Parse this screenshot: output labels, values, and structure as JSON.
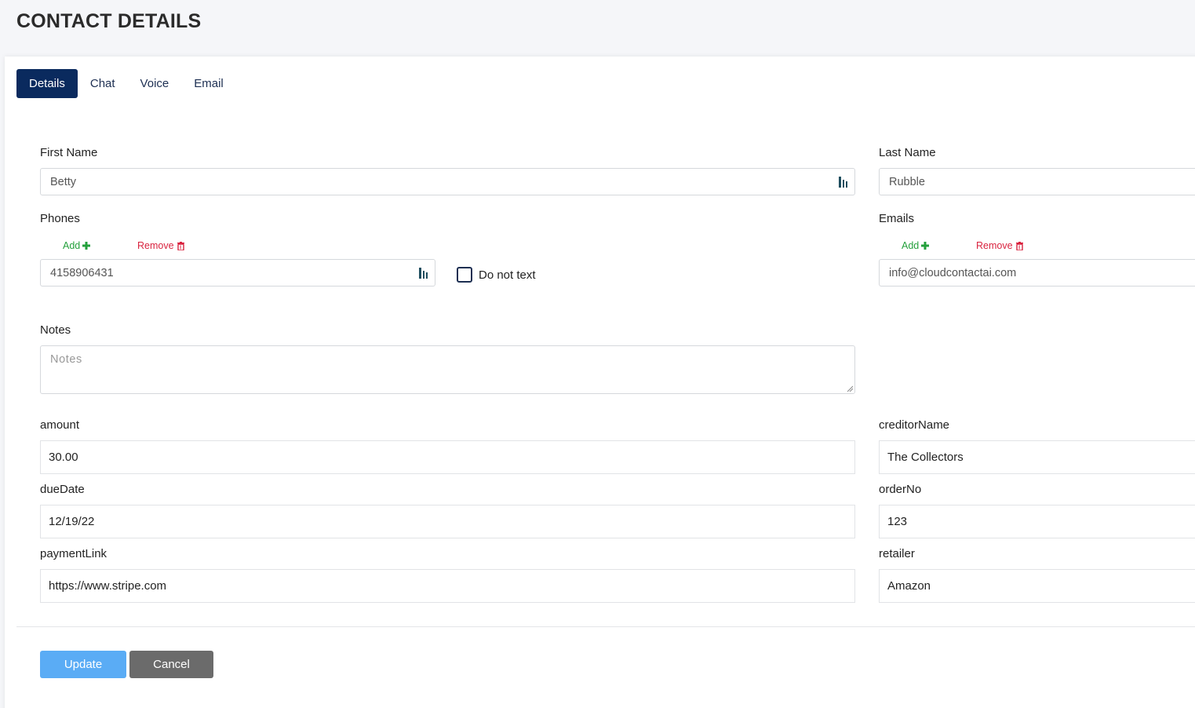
{
  "page": {
    "title": "CONTACT DETAILS"
  },
  "tabs": [
    {
      "label": "Details",
      "active": true
    },
    {
      "label": "Chat",
      "active": false
    },
    {
      "label": "Voice",
      "active": false
    },
    {
      "label": "Email",
      "active": false
    }
  ],
  "form": {
    "first_name": {
      "label": "First Name",
      "value": "Betty"
    },
    "last_name": {
      "label": "Last Name",
      "value": "Rubble"
    },
    "phones": {
      "label": "Phones",
      "add_label": "Add",
      "remove_label": "Remove",
      "value": "4158906431"
    },
    "do_not_text": {
      "label": "Do not text",
      "checked": false
    },
    "emails": {
      "label": "Emails",
      "add_label": "Add",
      "remove_label": "Remove",
      "value": "info@cloudcontactai.com"
    },
    "notes": {
      "label": "Notes",
      "placeholder": "Notes"
    },
    "custom": {
      "amount": {
        "label": "amount",
        "value": "30.00"
      },
      "creditorName": {
        "label": "creditorName",
        "value": "The Collectors"
      },
      "dueDate": {
        "label": "dueDate",
        "value": "12/19/22"
      },
      "orderNo": {
        "label": "orderNo",
        "value": "123"
      },
      "paymentLink": {
        "label": "paymentLink",
        "value": "https://www.stripe.com"
      },
      "retailer": {
        "label": "retailer",
        "value": "Amazon"
      }
    }
  },
  "buttons": {
    "update": "Update",
    "cancel": "Cancel"
  },
  "colors": {
    "tab_active_bg": "#0a2a5e",
    "add_green": "#24a03c",
    "remove_red": "#d9233f",
    "update_blue": "#5aacf5",
    "cancel_gray": "#6b6b6b"
  }
}
